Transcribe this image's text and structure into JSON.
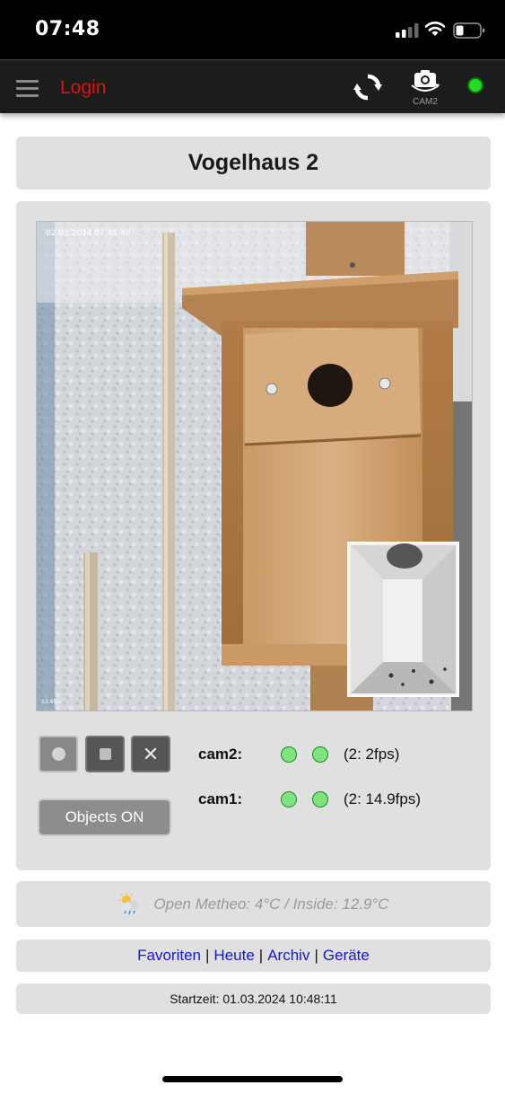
{
  "status_bar": {
    "time": "07:48"
  },
  "navbar": {
    "login_label": "Login",
    "camera_switch_label": "CAM2",
    "connection_status_color": "#22dd22"
  },
  "title": "Vogelhaus 2",
  "camera": {
    "timestamp_overlay": "02.03.2024  07:48:49",
    "fps_overlay": "13.4fps"
  },
  "controls": {
    "record_icon": "record-icon",
    "stop_icon": "stop-icon",
    "close_icon": "close-icon",
    "objects_button_label": "Objects ON"
  },
  "cameras": [
    {
      "name": "cam2:",
      "fps": "(2: 2fps)"
    },
    {
      "name": "cam1:",
      "fps": "(2: 14.9fps)"
    }
  ],
  "weather": {
    "icon": "cloud-sun-rain-icon",
    "text": "Open Metheo: 4°C / Inside: 12.9°C"
  },
  "links": [
    {
      "label": "Favoriten"
    },
    {
      "label": "Heute"
    },
    {
      "label": "Archiv"
    },
    {
      "label": "Geräte"
    }
  ],
  "link_separator": "|",
  "start_time": "Startzeit: 01.03.2024 10:48:11",
  "colors": {
    "login": "#e01010",
    "link": "#1717c8",
    "panel_bg": "#e0e0e0",
    "led_green": "#7fe37f"
  }
}
